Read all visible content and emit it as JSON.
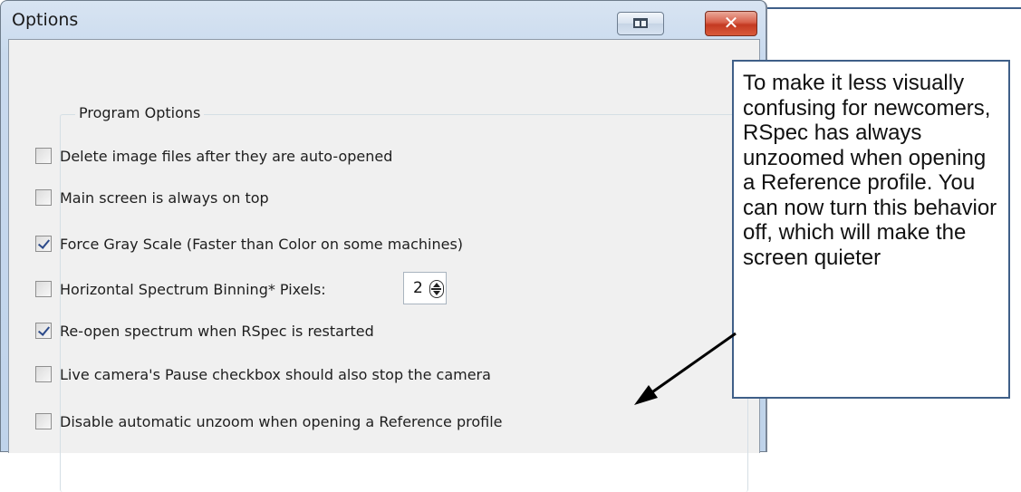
{
  "window": {
    "title": "Options",
    "restore_icon": "restore-icon",
    "close_glyph": "✕"
  },
  "group": {
    "label": "Program Options",
    "options": [
      {
        "label": "Delete image files after they are auto-opened",
        "checked": false
      },
      {
        "label": "Main screen is always on top",
        "checked": false
      },
      {
        "label": "Force Gray Scale  (Faster than Color on some machines)",
        "checked": true
      },
      {
        "label": "Horizontal Spectrum Binning*  Pixels:",
        "checked": false
      },
      {
        "label": "Re-open spectrum when RSpec is restarted",
        "checked": true
      },
      {
        "label": "Live camera's Pause checkbox should also stop the camera",
        "checked": false
      },
      {
        "label": "Disable automatic unzoom when opening a Reference profile",
        "checked": false
      }
    ],
    "binning_pixels": "2"
  },
  "callout": {
    "text": "To make it less visually confusing for newcomers, RSpec has always unzoomed when opening a Reference profile. You can now turn this behavior off, which will make the screen quieter"
  },
  "colors": {
    "callout_border": "#3f5f88",
    "checkmark": "#2c4a8a",
    "close_button": "#c43a22"
  }
}
